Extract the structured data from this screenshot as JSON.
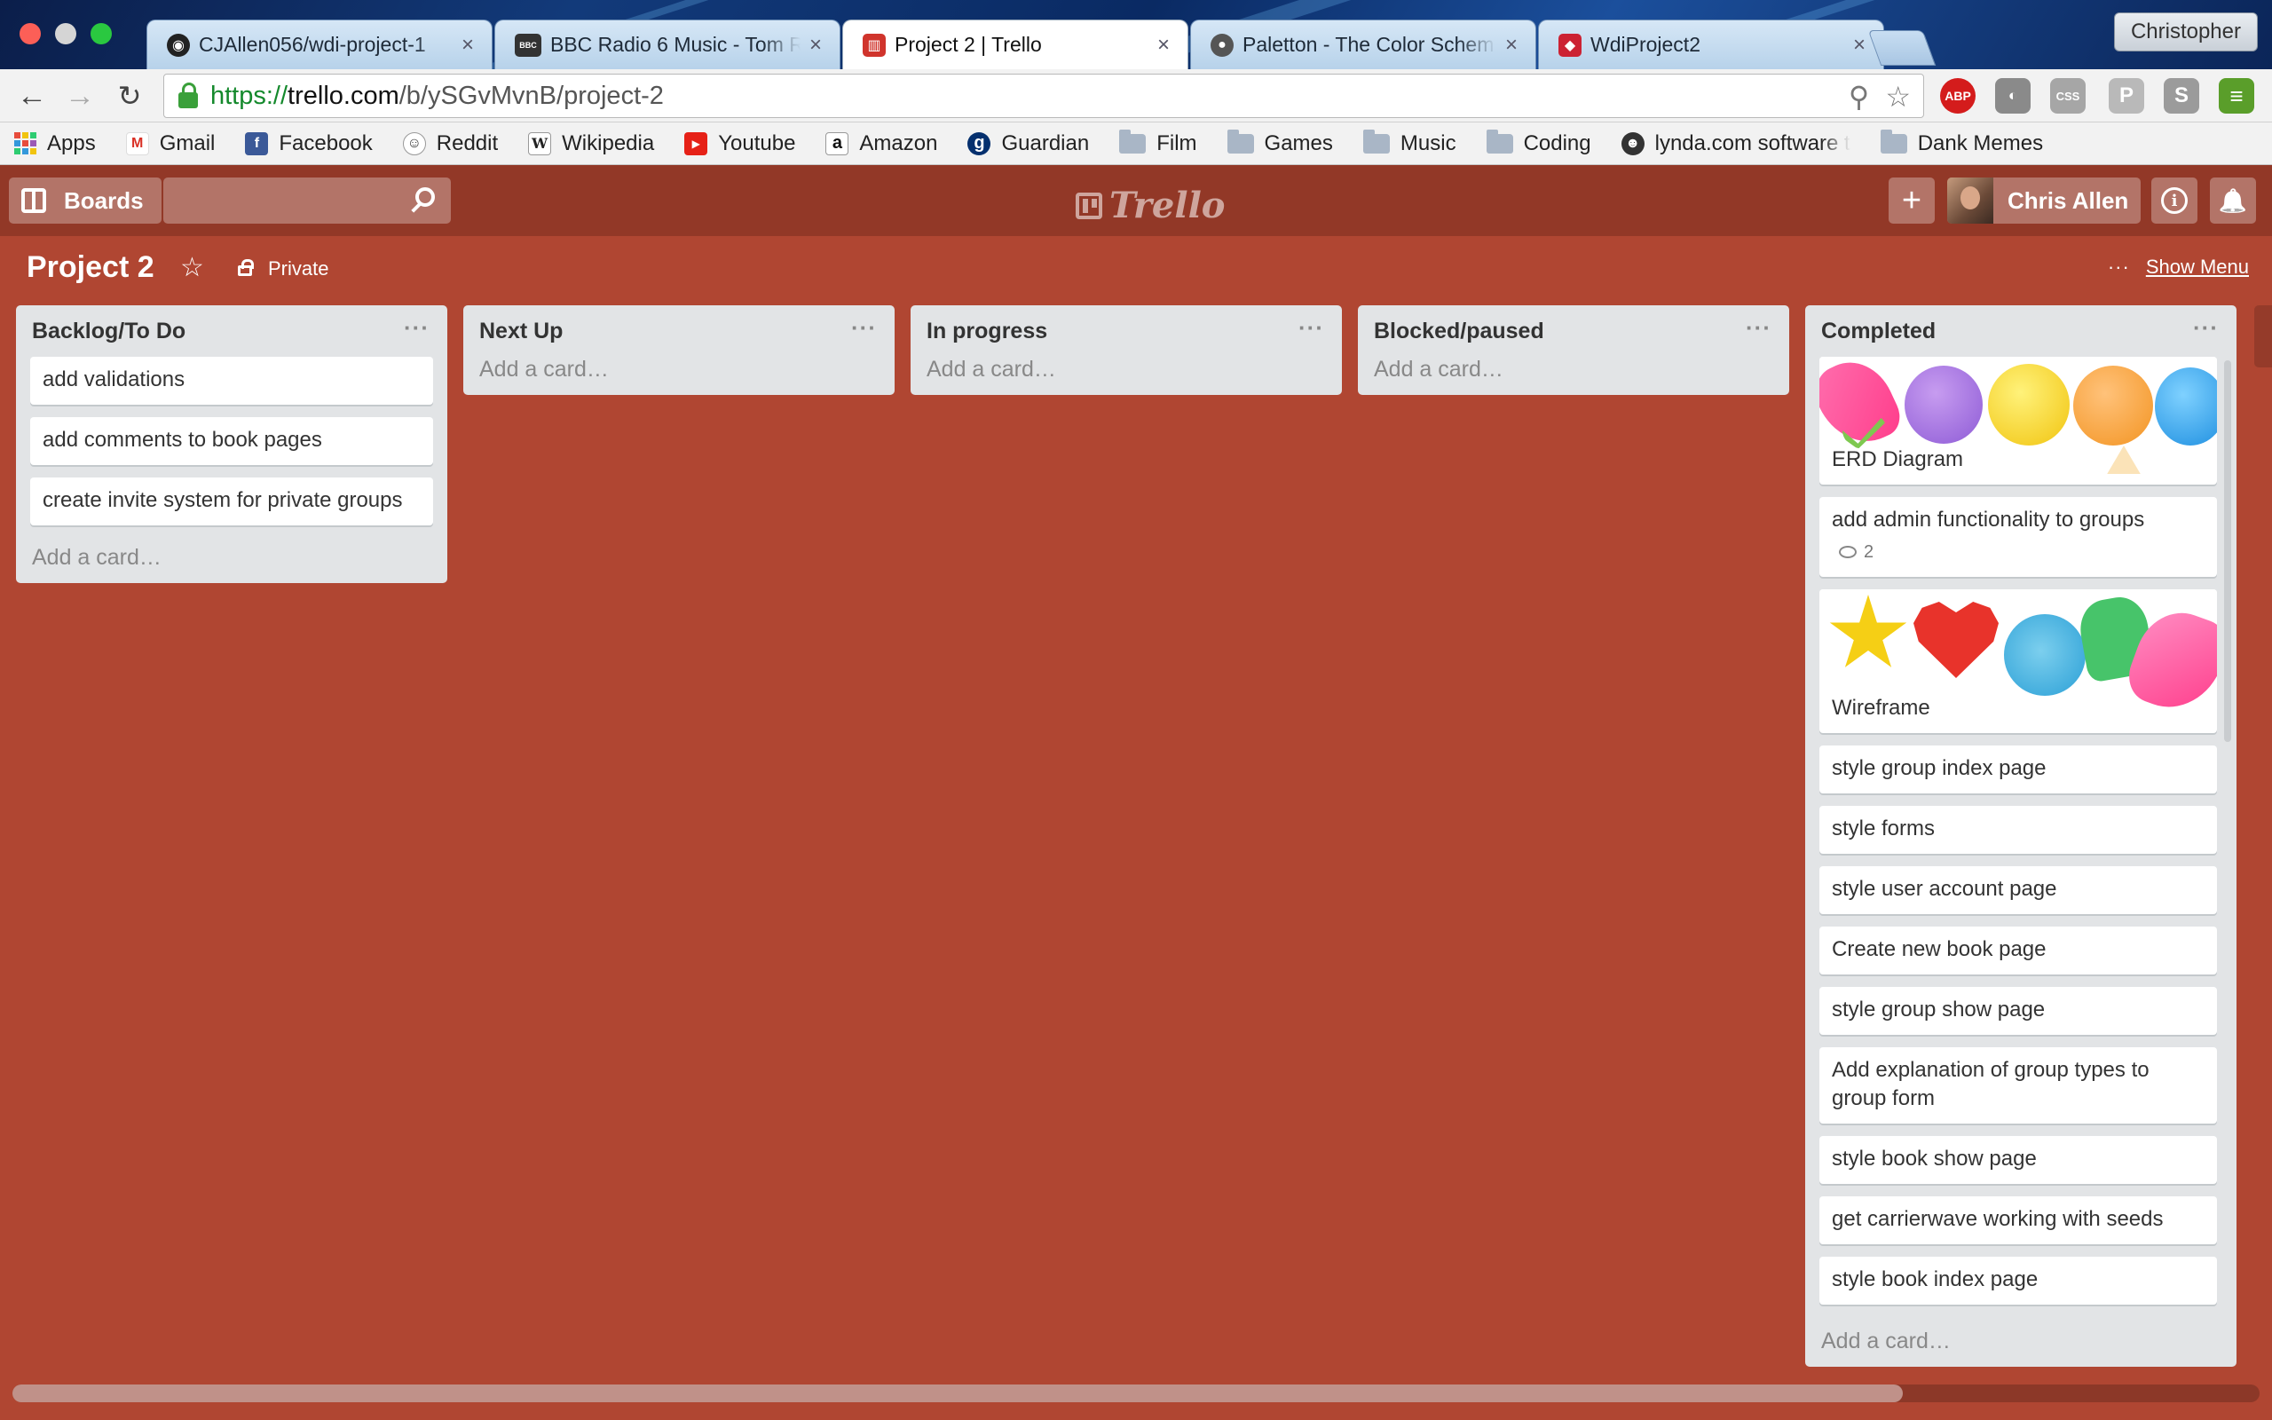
{
  "browser": {
    "tabs": [
      {
        "title": "CJAllen056/wdi-project-1",
        "icon": "github-icon",
        "active": false
      },
      {
        "title": "BBC Radio 6 Music - Tom R",
        "icon": "bbc-icon",
        "active": false
      },
      {
        "title": "Project 2 | Trello",
        "icon": "trello-icon",
        "active": true
      },
      {
        "title": "Paletton - The Color Schem",
        "icon": "paletton-icon",
        "active": false
      },
      {
        "title": "WdiProject2",
        "icon": "ruby-icon",
        "active": false
      }
    ],
    "profile_name": "Christopher",
    "url": {
      "scheme": "https://",
      "host": "trello.com",
      "path": "/b/ySGvMvnB/project-2"
    },
    "extensions": [
      "ABP",
      "CSS",
      "P",
      "S"
    ],
    "bookmarks": [
      {
        "label": "Apps",
        "icon": "apps-grid-icon"
      },
      {
        "label": "Gmail",
        "icon": "gmail-icon"
      },
      {
        "label": "Facebook",
        "icon": "facebook-icon"
      },
      {
        "label": "Reddit",
        "icon": "reddit-icon"
      },
      {
        "label": "Wikipedia",
        "icon": "wikipedia-icon"
      },
      {
        "label": "Youtube",
        "icon": "youtube-icon"
      },
      {
        "label": "Amazon",
        "icon": "amazon-icon"
      },
      {
        "label": "Guardian",
        "icon": "guardian-icon"
      },
      {
        "label": "Film",
        "icon": "folder-icon"
      },
      {
        "label": "Games",
        "icon": "folder-icon"
      },
      {
        "label": "Music",
        "icon": "folder-icon"
      },
      {
        "label": "Coding",
        "icon": "folder-icon"
      },
      {
        "label": "lynda.com software t",
        "icon": "lynda-icon"
      },
      {
        "label": "Dank Memes",
        "icon": "folder-icon"
      }
    ]
  },
  "trello": {
    "boards_label": "Boards",
    "logo_text": "Trello",
    "user_name": "Chris Allen",
    "add_glyph": "+",
    "info_glyph": "i",
    "bell_glyph": "🔔"
  },
  "board": {
    "title": "Project 2",
    "star_glyph": "☆",
    "visibility": "Private",
    "show_menu": "Show Menu",
    "menu_dots": "···",
    "add_card": "Add a card…"
  },
  "lists": [
    {
      "name": "Backlog/To Do",
      "cards": [
        "add validations",
        "add comments to book pages",
        "create invite system for private groups"
      ]
    },
    {
      "name": "Next Up",
      "cards": []
    },
    {
      "name": "In progress",
      "cards": []
    },
    {
      "name": "Blocked/paused",
      "cards": []
    },
    {
      "name": "Completed",
      "cover_cards": [
        "ERD Diagram",
        "Wireframe"
      ],
      "comment_card": {
        "title": "add admin functionality to groups",
        "comments": "2"
      },
      "cards": [
        "style group index page",
        "style forms",
        "style user account page",
        "Create new book page",
        "style group show page",
        "Add explanation of group types to group form",
        "style book show page",
        "get carrierwave working with seeds",
        "style book index page"
      ]
    }
  ],
  "colors": {
    "board_background": "#b04632",
    "header_background": "#923827",
    "list_background": "#e2e4e6"
  }
}
